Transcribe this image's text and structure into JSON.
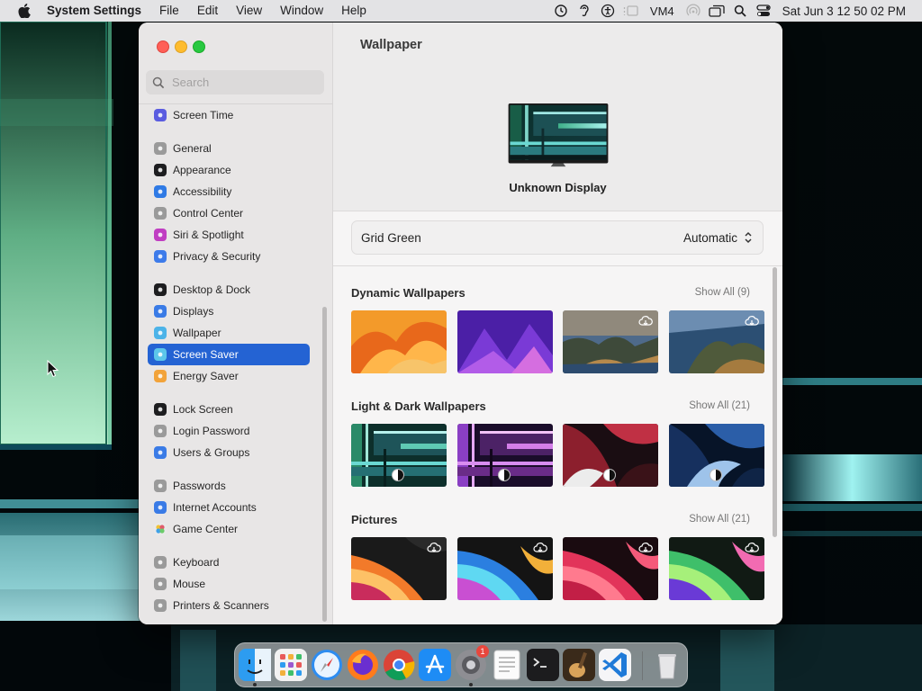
{
  "menubar": {
    "app_name": "System Settings",
    "menus": [
      "File",
      "Edit",
      "View",
      "Window",
      "Help"
    ],
    "status_text": "VM4",
    "clock": "Sat Jun 3  12 50 02 PM"
  },
  "window": {
    "search_placeholder": "Search",
    "sidebar": {
      "groups": [
        [
          {
            "label": "Screen Time",
            "icon": "hourglass-icon",
            "color": "#5a5ce0"
          }
        ],
        [
          {
            "label": "General",
            "icon": "gear-icon",
            "color": "#9a9a9a"
          },
          {
            "label": "Appearance",
            "icon": "appearance-icon",
            "color": "#1d1d1f"
          },
          {
            "label": "Accessibility",
            "icon": "accessibility-icon",
            "color": "#2f7ae5"
          },
          {
            "label": "Control Center",
            "icon": "control-center-icon",
            "color": "#9a9a9a"
          },
          {
            "label": "Siri & Spotlight",
            "icon": "siri-icon",
            "color": "#c03dc2"
          },
          {
            "label": "Privacy & Security",
            "icon": "hand-icon",
            "color": "#3d7bea"
          }
        ],
        [
          {
            "label": "Desktop & Dock",
            "icon": "dock-icon",
            "color": "#1d1d1f"
          },
          {
            "label": "Displays",
            "icon": "sun-icon",
            "color": "#3a7be6"
          },
          {
            "label": "Wallpaper",
            "icon": "wallpaper-icon",
            "color": "#4cb3e8"
          },
          {
            "label": "Screen Saver",
            "icon": "screen-saver-icon",
            "color": "#5cc6ea"
          },
          {
            "label": "Energy Saver",
            "icon": "battery-icon",
            "color": "#f2a33a"
          }
        ],
        [
          {
            "label": "Lock Screen",
            "icon": "lock-icon",
            "color": "#1d1d1f"
          },
          {
            "label": "Login Password",
            "icon": "padlock-icon",
            "color": "#9a9a9a"
          },
          {
            "label": "Users & Groups",
            "icon": "users-icon",
            "color": "#3a7be6"
          }
        ],
        [
          {
            "label": "Passwords",
            "icon": "key-icon",
            "color": "#9a9a9a"
          },
          {
            "label": "Internet Accounts",
            "icon": "at-icon",
            "color": "#3a7be6"
          },
          {
            "label": "Game Center",
            "icon": "game-center-icon",
            "color": "#e9e9e9"
          }
        ],
        [
          {
            "label": "Keyboard",
            "icon": "keyboard-icon",
            "color": "#9a9a9a"
          },
          {
            "label": "Mouse",
            "icon": "mouse-icon",
            "color": "#9a9a9a"
          },
          {
            "label": "Printers & Scanners",
            "icon": "printer-icon",
            "color": "#9a9a9a"
          }
        ]
      ],
      "selected": "Screen Saver"
    },
    "content": {
      "title": "Wallpaper",
      "display_name": "Unknown Display",
      "current_wallpaper": "Grid Green",
      "appearance_select": "Automatic",
      "sections": [
        {
          "title": "Dynamic Wallpapers",
          "show_all": "Show All (9)",
          "thumbs": [
            "ventura-orange",
            "monterey-purple",
            "catalina-coast",
            "catalina-island"
          ]
        },
        {
          "title": "Light & Dark Wallpapers",
          "show_all": "Show All (21)",
          "thumbs": [
            "grid-green",
            "grid-purple",
            "waves-red",
            "waves-blue"
          ]
        },
        {
          "title": "Pictures",
          "show_all": "Show All (21)",
          "thumbs": [
            "flow-orange",
            "flow-blue",
            "flow-pink",
            "flow-green"
          ]
        }
      ]
    }
  },
  "dock": {
    "apps": [
      "Finder",
      "Launchpad",
      "Safari",
      "Firefox",
      "Chrome",
      "App Store",
      "System Settings",
      "TextEdit",
      "Terminal",
      "Guitar",
      "Visual Studio Code",
      "Trash"
    ],
    "settings_badge": "1"
  }
}
